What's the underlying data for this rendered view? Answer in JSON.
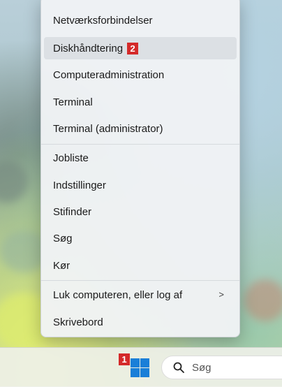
{
  "context_menu": {
    "items": [
      {
        "label": "Netværksforbindelser"
      },
      {
        "label": "Diskhåndtering",
        "badge": "2"
      },
      {
        "label": "Computeradministration"
      },
      {
        "label": "Terminal"
      },
      {
        "label": "Terminal (administrator)"
      },
      {
        "label": "Jobliste"
      },
      {
        "label": "Indstillinger"
      },
      {
        "label": "Stifinder"
      },
      {
        "label": "Søg"
      },
      {
        "label": "Kør"
      },
      {
        "label": "Luk computeren, eller log af",
        "submenu_arrow": ">"
      },
      {
        "label": "Skrivebord"
      }
    ]
  },
  "taskbar": {
    "start_badge": "1",
    "start_icon": "windows-logo-icon",
    "search_icon": "search-icon",
    "search_placeholder": "Søg",
    "accent_color": "#1a7fd8"
  }
}
